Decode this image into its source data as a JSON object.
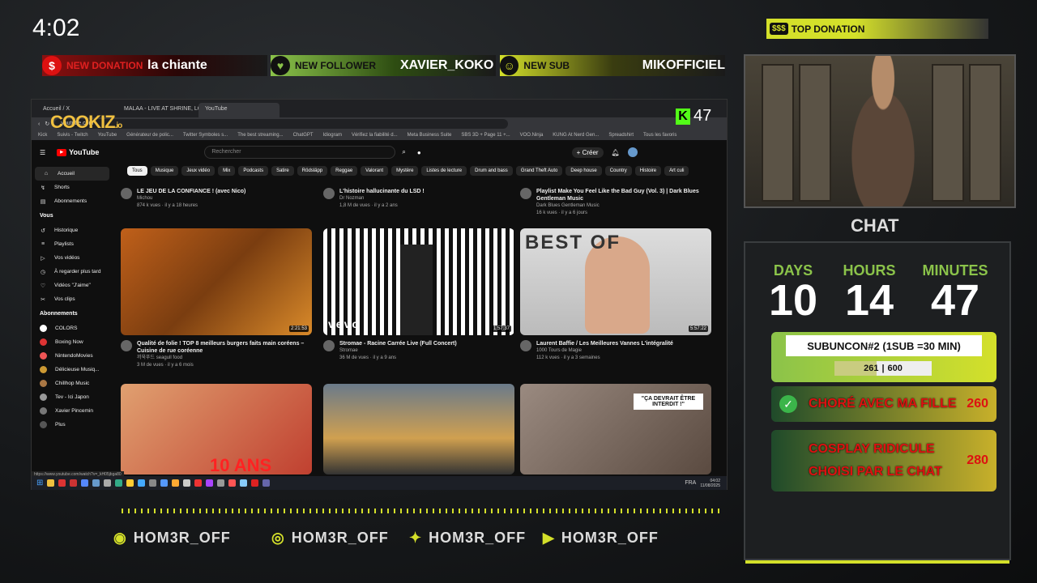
{
  "clock": "4:02",
  "alerts": {
    "donation": {
      "label": "NEW DONATION",
      "value": "la chiante",
      "icon": "$"
    },
    "follower": {
      "label": "NEW FOLLOWER",
      "value": "XAVIER_KOKO",
      "icon": "♥"
    },
    "sub": {
      "label": "NEW SUB",
      "value": "MIKOFFICIEL",
      "icon": "☺"
    }
  },
  "top_donation": {
    "icon": "$$$",
    "label": "TOP DONATION"
  },
  "chat_label": "CHAT",
  "countdown": {
    "days_label": "DAYS",
    "days": "10",
    "hours_label": "HOURS",
    "hours": "14",
    "minutes_label": "MINUTES",
    "minutes": "47"
  },
  "goal": {
    "title": "SUBUNCON#2 (1SUB =30 MIN)",
    "current": "261",
    "separator": "|",
    "target": "600",
    "progress": 0.435
  },
  "challenges": [
    {
      "text": "CHORÉ AVEC MA FILLE",
      "points": "260",
      "done": true
    },
    {
      "text": "COSPLAY RIDICULE CHOISI PAR LE CHAT",
      "points": "280",
      "done": false
    }
  ],
  "socials": [
    {
      "icon": "discord-icon",
      "glyph": "◉",
      "handle": "HOM3R_OFF"
    },
    {
      "icon": "instagram-icon",
      "glyph": "◎",
      "handle": "HOM3R_OFF"
    },
    {
      "icon": "twitter-icon",
      "glyph": "✦",
      "handle": "HOM3R_OFF"
    },
    {
      "icon": "youtube-icon",
      "glyph": "▶",
      "handle": "HOM3R_OFF"
    }
  ],
  "overlay": {
    "cookiz": "COOKIZ",
    "cookiz_suffix": ".io",
    "kick_letter": "K",
    "kick_count": "47"
  },
  "browser": {
    "tabs": [
      "Accueil / X",
      "MALAA - LIVE AT SHRINE, LOS ANGE",
      "YouTube"
    ],
    "url": "youtube.com",
    "bookmarks": [
      "Kick",
      "Suivis - Twitch",
      "YouTube",
      "Générateur de polic...",
      "Twitter Symboles s...",
      "The best streaming...",
      "ChatGPT",
      "Idiogram",
      "Vérifiez la fiabilité d...",
      "Meta Business Suite",
      "SBS 3D + Page 11 +...",
      "VOO.Ninja",
      "KUNG At Nerd Gen...",
      "Spreadshirt",
      "Tous les favoris"
    ]
  },
  "youtube": {
    "logo": "YouTube",
    "search_placeholder": "Rechercher",
    "create": "+ Créer",
    "nav": [
      "Accueil",
      "Shorts",
      "Abonnements"
    ],
    "you_header": "Vous",
    "you_items": [
      "Historique",
      "Playlists",
      "Vos vidéos",
      "À regarder plus tard",
      "Vidéos \"J'aime\"",
      "Vos clips"
    ],
    "subs_header": "Abonnements",
    "subs": [
      "COLORS",
      "Boxing Now",
      "NintendoMovies",
      "Délicieuse Musiq...",
      "Chillhop Music",
      "Tev - Ici Japon",
      "Xavier Pincemin",
      "Plus"
    ],
    "chips": [
      "Tous",
      "Musique",
      "Jeux vidéo",
      "Mix",
      "Podcasts",
      "Satire",
      "Rödsläpp",
      "Reggae",
      "Valorant",
      "Mystère",
      "Listes de lecture",
      "Drum and bass",
      "Grand Theft Auto",
      "Deep house",
      "Country",
      "Histoire",
      "Art culi"
    ],
    "row0": [
      {
        "title": "LE JEU DE LA CONFIANCE ! (avec Nico)",
        "channel": "Michou",
        "stats": "874 k vues · il y a 18 heures"
      },
      {
        "title": "L'histoire hallucinante du LSD !",
        "channel": "Dr Nozman",
        "stats": "1,8 M de vues · il y a 2 ans"
      },
      {
        "title": "Playlist Make You Feel Like the Bad Guy (Vol. 3) | Dark Blues Gentleman Music",
        "channel": "Dark Blues Gentleman Music",
        "stats": "16 k vues · il y a 6 jours"
      }
    ],
    "row1": [
      {
        "title": "Qualité de folie ! TOP 8 meilleurs burgers faits main coréens – Cuisine de rue coréenne",
        "channel": "끼욱푸드 seagull food",
        "stats": "3 M de vues · il y a 6 mois",
        "duration": "2:21:53",
        "overlay": ""
      },
      {
        "title": "Stromae - Racine Carrée Live (Full Concert)",
        "channel": "Stromae",
        "stats": "36 M de vues · il y a 9 ans",
        "duration": "1:57:37",
        "overlay": "vevo"
      },
      {
        "title": "Laurent Baffie / Les Meilleures Vannes L'intégralité",
        "channel": "1000 Tours de Magie",
        "stats": "112 k vues · il y a 3 semaines",
        "duration": "5:57:22",
        "overlay": "BEST OF"
      }
    ],
    "row2_overlays": [
      "10 ANS",
      "",
      "\"ÇA DEVRAIT ÊTRE INTERDIT !\""
    ],
    "status_url": "https://www.youtube.com/watch?v=_kH05jbga80"
  },
  "taskbar": {
    "lang": "FRA",
    "time": "04:02",
    "date": "11/08/2025"
  }
}
